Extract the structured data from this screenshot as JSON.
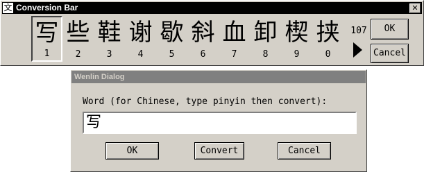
{
  "conversion_bar": {
    "title": "Conversion Bar",
    "app_icon": "文",
    "close_label": "✕",
    "candidates": [
      {
        "char": "写",
        "key": "1",
        "selected": true
      },
      {
        "char": "些",
        "key": "2"
      },
      {
        "char": "鞋",
        "key": "3"
      },
      {
        "char": "谢",
        "key": "4"
      },
      {
        "char": "歇",
        "key": "5"
      },
      {
        "char": "斜",
        "key": "6"
      },
      {
        "char": "血",
        "key": "7"
      },
      {
        "char": "卸",
        "key": "8"
      },
      {
        "char": "楔",
        "key": "9"
      },
      {
        "char": "挟",
        "key": "0"
      }
    ],
    "more_count": "107",
    "ok_label": "OK",
    "cancel_label": "Cancel"
  },
  "dialog": {
    "title": "Wenlin Dialog",
    "prompt": "Word (for Chinese, type pinyin then convert):",
    "input_value": "写",
    "ok_label": "OK",
    "convert_label": "Convert",
    "cancel_label": "Cancel"
  },
  "colors": {
    "face": "#d4d0c8",
    "active_title": "#000000",
    "inactive_title": "#808080"
  }
}
